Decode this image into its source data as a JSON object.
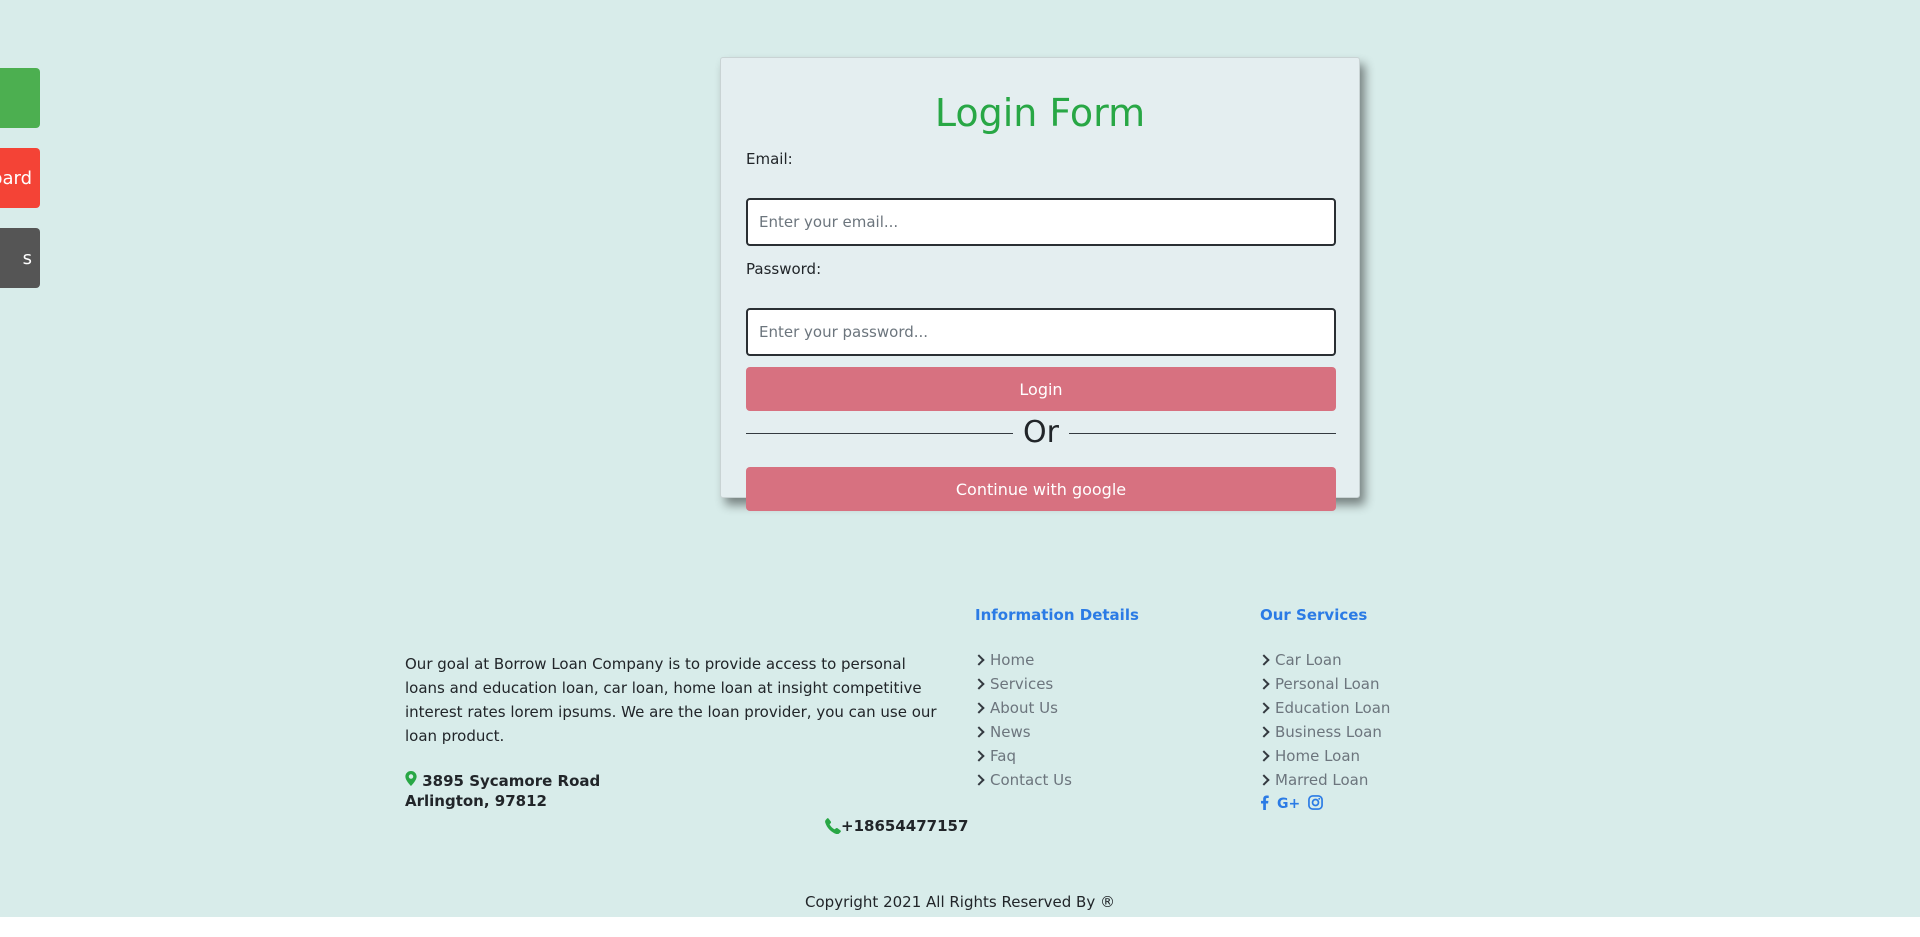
{
  "side_buttons": [
    {
      "label": "",
      "color": "#4caf50"
    },
    {
      "label": "board",
      "color": "#f44336"
    },
    {
      "label": "s",
      "color": "#555555"
    }
  ],
  "login": {
    "title": "Login Form",
    "email_label": "Email:",
    "email_placeholder": "Enter your email...",
    "password_label": "Password:",
    "password_placeholder": "Enter your password...",
    "login_button": "Login",
    "or_text": "Or",
    "google_button": "Continue with google"
  },
  "footer": {
    "about": "Our goal at Borrow Loan Company is to provide access to personal loans and education loan, car loan, home loan at insight competitive interest rates lorem ipsums. We are the loan provider, you can use our loan product.",
    "address": "3895 Sycamore Road Arlington, 97812",
    "phone": "+18654477157",
    "info": {
      "title": "Information Details",
      "items": [
        "Home",
        "Services",
        "About Us",
        "News",
        "Faq",
        "Contact Us"
      ]
    },
    "services": {
      "title": "Our Services",
      "items": [
        "Car Loan",
        "Personal Loan",
        "Education Loan",
        "Business Loan",
        "Home Loan",
        "Marred Loan"
      ]
    },
    "social": [
      "facebook-icon",
      "google-plus-icon",
      "instagram-icon"
    ],
    "google_plus_text": "G+",
    "copyright": "Copyright 2021 All Rights Reserved By ®"
  },
  "colors": {
    "background": "#d8ecea",
    "title_green": "#28a745",
    "button_pink": "#d77180",
    "link_blue": "#2b7be5"
  }
}
